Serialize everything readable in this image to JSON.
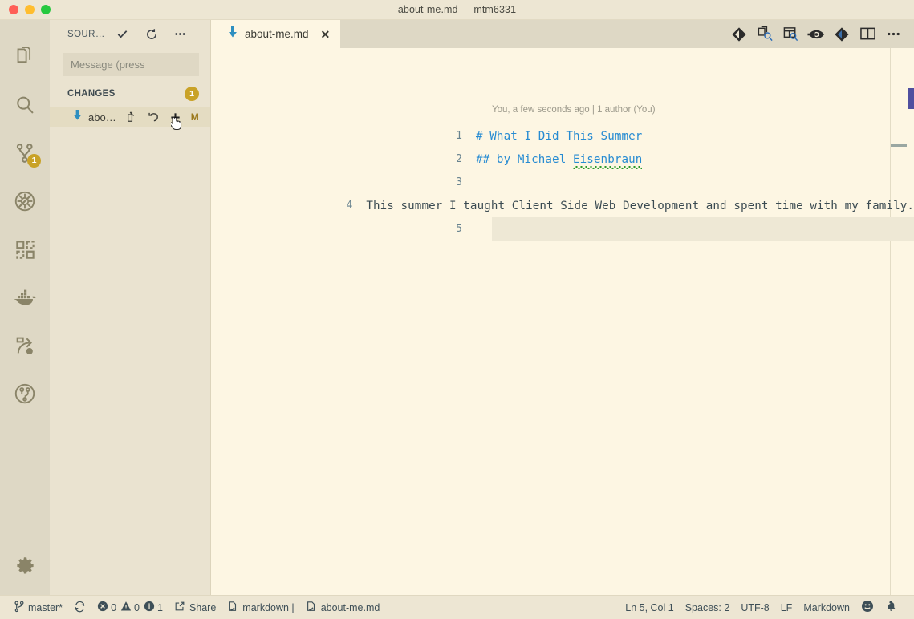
{
  "window": {
    "title": "about-me.md — mtm6331",
    "traffic_lights": [
      "close",
      "minimize",
      "zoom"
    ]
  },
  "activity_bar": {
    "items": [
      {
        "name": "explorer",
        "icon": "files-icon",
        "badge": null
      },
      {
        "name": "search",
        "icon": "search-icon",
        "badge": null
      },
      {
        "name": "source-control",
        "icon": "source-control-icon",
        "badge": "1"
      },
      {
        "name": "run-and-debug",
        "icon": "run-debug-icon",
        "badge": null
      },
      {
        "name": "extensions",
        "icon": "extensions-icon",
        "badge": null
      },
      {
        "name": "docker",
        "icon": "docker-icon",
        "badge": null
      },
      {
        "name": "live-share",
        "icon": "live-share-icon",
        "badge": null
      },
      {
        "name": "git-graph",
        "icon": "git-graph-icon",
        "badge": null
      }
    ],
    "bottom": {
      "name": "manage-settings",
      "icon": "gear-icon"
    }
  },
  "sidebar": {
    "title": "SOUR…",
    "actions": [
      {
        "name": "commit",
        "icon": "check-icon"
      },
      {
        "name": "refresh",
        "icon": "refresh-icon"
      },
      {
        "name": "more-actions",
        "icon": "ellipsis-icon"
      }
    ],
    "commit_input": {
      "placeholder": "Message (press"
    },
    "changes": {
      "label": "CHANGES",
      "count": "1",
      "rows": [
        {
          "file": "abo…",
          "status": "M",
          "actions": [
            {
              "name": "open-file",
              "icon": "open-file-icon"
            },
            {
              "name": "discard-changes",
              "icon": "discard-icon"
            },
            {
              "name": "stage-changes",
              "icon": "plus-icon"
            }
          ]
        }
      ]
    }
  },
  "editor": {
    "tabs": [
      {
        "label": "about-me.md",
        "icon": "markdown-icon",
        "active": true,
        "close_label": "✕"
      }
    ],
    "toolbar": [
      {
        "name": "open-changes",
        "icon": "git-compare-icon"
      },
      {
        "name": "open-preview-to-side",
        "icon": "preview-search-icon"
      },
      {
        "name": "open-preview",
        "icon": "preview-panel-icon"
      },
      {
        "name": "toggle-blame",
        "icon": "eye-arrow-icon"
      },
      {
        "name": "git-actions",
        "icon": "git-diamond-icon"
      },
      {
        "name": "split-editor",
        "icon": "split-editor-icon"
      },
      {
        "name": "more-actions",
        "icon": "ellipsis-icon"
      }
    ],
    "blame_annotation": "You, a few seconds ago | 1 author (You)",
    "lines": [
      {
        "number": "1",
        "text": "# What I Did This Summer",
        "style": "heading",
        "active": false
      },
      {
        "number": "2",
        "text": "## by Michael Eisenbraun",
        "style": "heading-spell",
        "prefix": "## by Michael ",
        "spell_word": "Eisenbraun",
        "active": false
      },
      {
        "number": "3",
        "text": "",
        "style": "plain",
        "active": false
      },
      {
        "number": "4",
        "text": "This summer I taught Client Side Web Development and spent time with my family.",
        "style": "plain",
        "active": false
      },
      {
        "number": "5",
        "text": "",
        "style": "plain",
        "active": true
      }
    ]
  },
  "status_bar": {
    "left": [
      {
        "name": "branch",
        "icon": "branch-icon",
        "label": "master*"
      },
      {
        "name": "sync-changes",
        "icon": "sync-icon",
        "label": ""
      },
      {
        "name": "problems",
        "errors": "0",
        "warnings": "0",
        "infos": "1"
      },
      {
        "name": "share",
        "icon": "share-icon",
        "label": "Share"
      },
      {
        "name": "markdown-lint",
        "icon": "file-check-icon",
        "label": "markdown |"
      },
      {
        "name": "current-file",
        "icon": "file-check-icon",
        "label": "about-me.md"
      }
    ],
    "right": [
      {
        "name": "cursor-position",
        "label": "Ln 5, Col 1"
      },
      {
        "name": "indentation",
        "label": "Spaces: 2"
      },
      {
        "name": "encoding",
        "label": "UTF-8"
      },
      {
        "name": "eol",
        "label": "LF"
      },
      {
        "name": "language-mode",
        "label": "Markdown"
      },
      {
        "name": "feedback",
        "icon": "smiley-icon",
        "label": ""
      },
      {
        "name": "notifications",
        "icon": "bell-icon",
        "label": ""
      }
    ]
  },
  "colors": {
    "editor_background": "#FDF6E3",
    "sidebar_background": "#EAE3D0",
    "activity_bar_background": "#DED8C5",
    "title_bar_background": "#EDE6D3",
    "accent_blue": "#268BD2",
    "badge_gold": "#C9A227",
    "modified_status": "#9C7A1E",
    "scrollbar_slider": "#4F4F9F",
    "spell_underline": "#2A9A2A"
  }
}
